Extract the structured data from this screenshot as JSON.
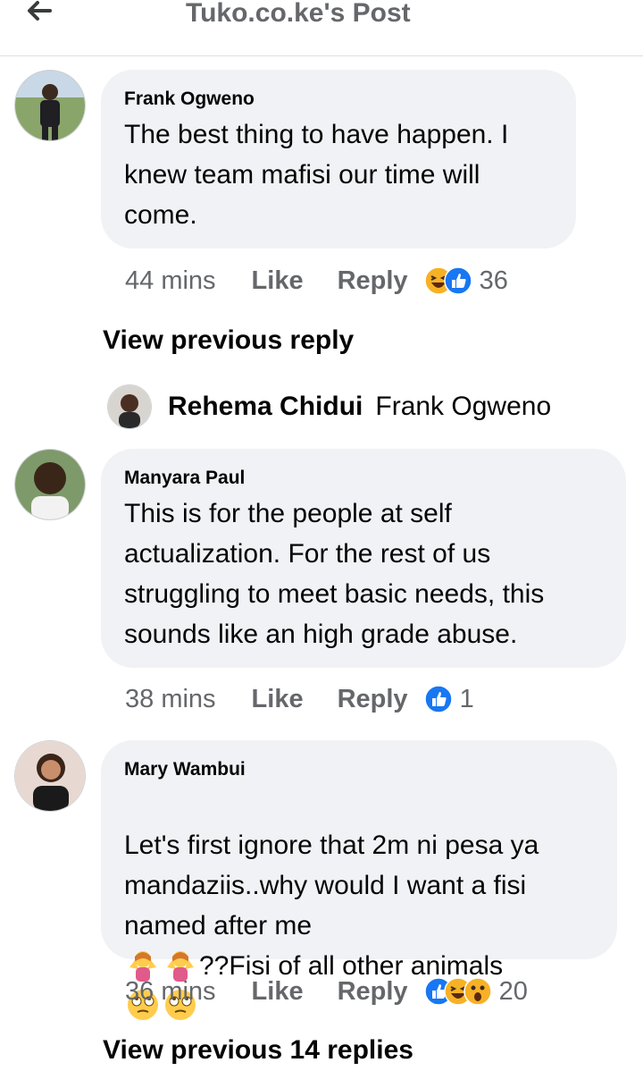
{
  "header": {
    "title": "Tuko.co.ke's Post",
    "back_icon": "arrow-left-icon"
  },
  "comments": [
    {
      "author": "Frank Ogweno",
      "text": "The best thing to have happen. I knew team mafisi our time will come.",
      "time": "44 mins",
      "like": "Like",
      "reply": "Reply",
      "reactions": [
        "haha",
        "like"
      ],
      "reaction_count": "36"
    },
    {
      "author": "Manyara Paul",
      "text": "This is for the people at self actualization. For the rest of us struggling to meet basic needs, this sounds like an high grade abuse.",
      "time": "38 mins",
      "like": "Like",
      "reply": "Reply",
      "reactions": [
        "like"
      ],
      "reaction_count": "1"
    },
    {
      "author": "Mary Wambui",
      "text_before": "Let's first ignore that 2m ni pesa ya mandaziis..why would I want a fisi named after me",
      "text_middle": "??Fisi of all other animals",
      "time": "36 mins",
      "like": "Like",
      "reply": "Reply",
      "reactions": [
        "like",
        "haha",
        "wow"
      ],
      "reaction_count": "20"
    }
  ],
  "view_previous_reply": "View previous reply",
  "reply_preview": {
    "author": "Rehema Chidui",
    "text": "Frank Ogweno"
  },
  "view_previous_replies": "View previous 14 replies",
  "colors": {
    "like_blue": "#1877f2",
    "reaction_yellow": "#f7b125",
    "bubble_bg": "#f0f2f5",
    "meta_gray": "#65676b"
  }
}
